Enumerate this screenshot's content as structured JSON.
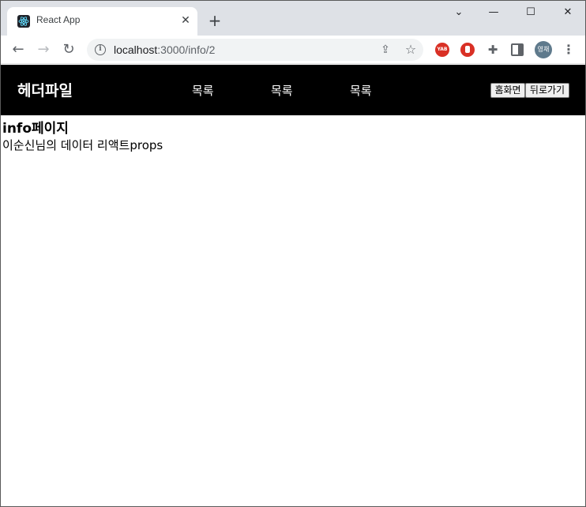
{
  "browser": {
    "tab_title": "React App",
    "tab_close": "✕",
    "new_tab": "+",
    "window_chevron": "⌄",
    "window_minimize": "—",
    "window_maximize": "☐",
    "window_close": "✕",
    "url_host": "localhost",
    "url_path": ":3000/info/2",
    "extensions": {
      "yab_label": "YAB",
      "avatar_label": "영채"
    }
  },
  "app": {
    "header": {
      "logo": "헤더파일",
      "nav": [
        "목록",
        "목록",
        "목록"
      ],
      "home_button": "홈화면",
      "back_button": "뒤로가기"
    },
    "page": {
      "title": "info페이지",
      "text": "이순신님의 데이터 리액트props"
    }
  },
  "colors": {
    "header_bg": "#000000",
    "tabstrip_bg": "#dee1e6",
    "omnibox_bg": "#f1f3f4",
    "ext_red": "#d93025"
  }
}
